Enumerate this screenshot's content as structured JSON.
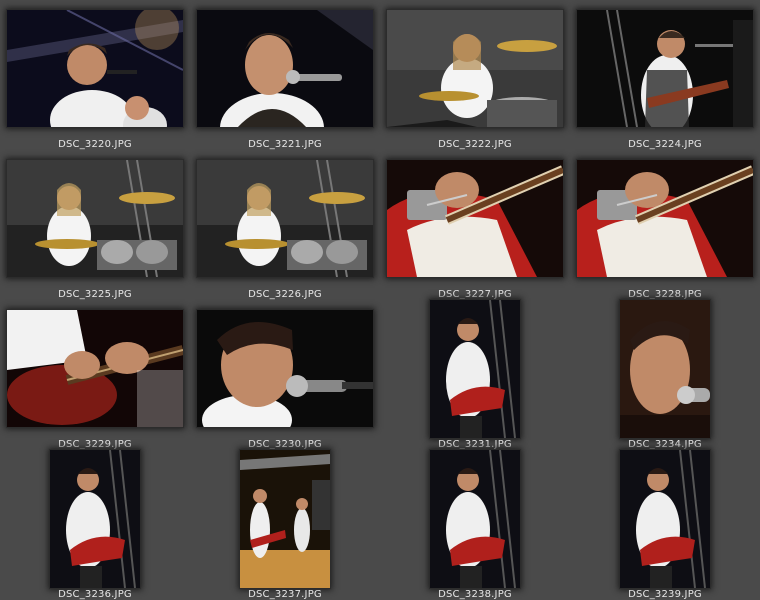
{
  "thumbnails": [
    {
      "filename": "DSC_3220.JPG",
      "orientation": "landscape",
      "scene": "singers-stage"
    },
    {
      "filename": "DSC_3221.JPG",
      "orientation": "landscape",
      "scene": "singer-closeup"
    },
    {
      "filename": "DSC_3222.JPG",
      "orientation": "landscape",
      "scene": "drummer"
    },
    {
      "filename": "DSC_3224.JPG",
      "orientation": "landscape",
      "scene": "guitarist-standing"
    },
    {
      "filename": "DSC_3225.JPG",
      "orientation": "landscape",
      "scene": "drummer-wide"
    },
    {
      "filename": "DSC_3226.JPG",
      "orientation": "landscape",
      "scene": "drummer-wide"
    },
    {
      "filename": "DSC_3227.JPG",
      "orientation": "landscape",
      "scene": "red-guitar-closeup"
    },
    {
      "filename": "DSC_3228.JPG",
      "orientation": "landscape",
      "scene": "red-guitar-closeup"
    },
    {
      "filename": "DSC_3229.JPG",
      "orientation": "landscape",
      "scene": "guitar-neck-closeup"
    },
    {
      "filename": "DSC_3230.JPG",
      "orientation": "landscape",
      "scene": "singer-profile"
    },
    {
      "filename": "DSC_3231.JPG",
      "orientation": "portrait",
      "scene": "guitarist-portrait"
    },
    {
      "filename": "DSC_3234.JPG",
      "orientation": "portrait",
      "scene": "singer-portrait"
    },
    {
      "filename": "DSC_3236.JPG",
      "orientation": "portrait",
      "scene": "guitarist-portrait"
    },
    {
      "filename": "DSC_3237.JPG",
      "orientation": "portrait",
      "scene": "stage-wide-portrait"
    },
    {
      "filename": "DSC_3238.JPG",
      "orientation": "portrait",
      "scene": "guitarist-portrait"
    },
    {
      "filename": "DSC_3239.JPG",
      "orientation": "portrait",
      "scene": "guitarist-portrait"
    }
  ],
  "colors": {
    "background": "#4a4a4a",
    "caption": "#e6e6e6",
    "thumb_frame": "#1a1a1a"
  }
}
